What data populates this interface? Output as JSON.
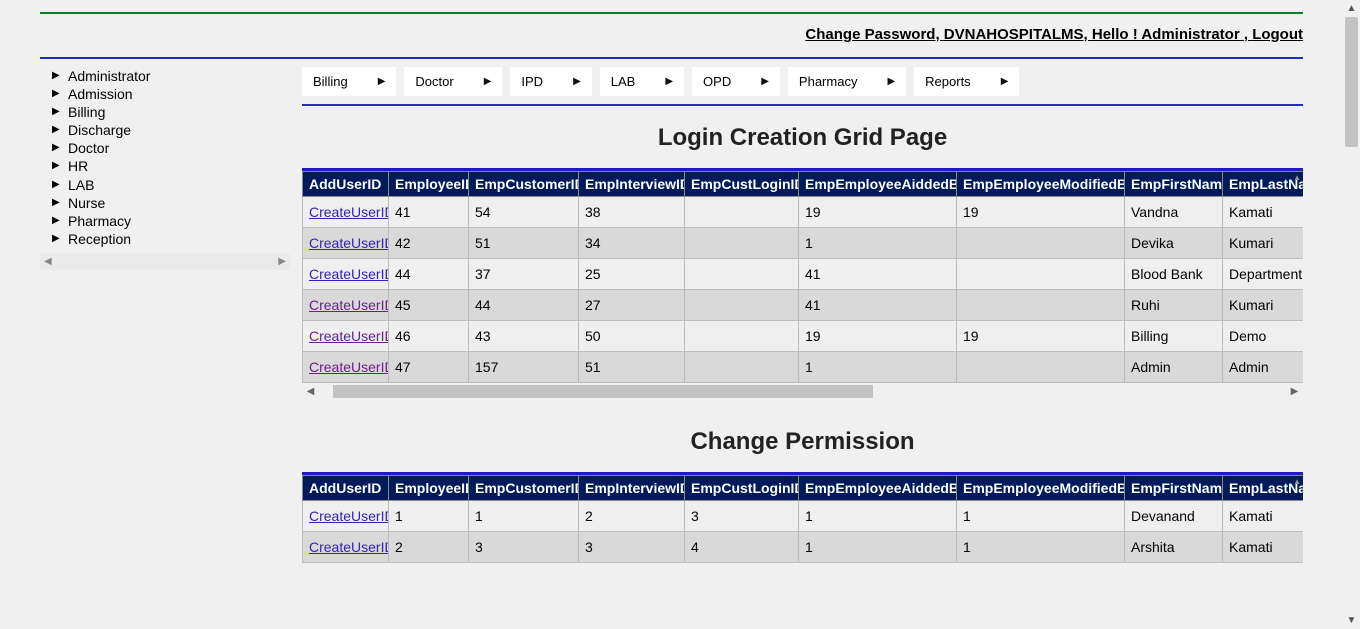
{
  "topbar": {
    "change_password": "Change Password",
    "brand": "DVNAHOSPITALMS",
    "greeting": "Hello ! Administrator ",
    "logout": "Logout"
  },
  "sidebar": {
    "items": [
      "Administrator",
      "Admission",
      "Billing",
      "Discharge",
      "Doctor",
      "HR",
      "LAB",
      "Nurse",
      "Pharmacy",
      "Reception"
    ]
  },
  "menu": {
    "items": [
      "Billing",
      "Doctor",
      "IPD",
      "LAB",
      "OPD",
      "Pharmacy",
      "Reports"
    ]
  },
  "section1": {
    "title": "Login Creation Grid Page",
    "link_label": "CreateUserID",
    "headers": [
      "AddUserID",
      "EmployeeID",
      "EmpCustomerID",
      "EmpInterviewID",
      "EmpCustLoginID",
      "EmpEmployeeAiddedBy",
      "EmpEmployeeModifiedBy",
      "EmpFirstName",
      "EmpLastName"
    ],
    "rows": [
      {
        "emp": "41",
        "cust": "54",
        "intv": "38",
        "login": "",
        "aid": "19",
        "mod": "19",
        "first": "Vandna",
        "last": "Kamati",
        "visited": false
      },
      {
        "emp": "42",
        "cust": "51",
        "intv": "34",
        "login": "",
        "aid": "1",
        "mod": "",
        "first": "Devika",
        "last": "Kumari",
        "visited": false
      },
      {
        "emp": "44",
        "cust": "37",
        "intv": "25",
        "login": "",
        "aid": "41",
        "mod": "",
        "first": "Blood Bank",
        "last": "Department",
        "visited": false
      },
      {
        "emp": "45",
        "cust": "44",
        "intv": "27",
        "login": "",
        "aid": "41",
        "mod": "",
        "first": "Ruhi",
        "last": "Kumari",
        "visited": true
      },
      {
        "emp": "46",
        "cust": "43",
        "intv": "50",
        "login": "",
        "aid": "19",
        "mod": "19",
        "first": "Billing",
        "last": "Demo",
        "visited": true
      },
      {
        "emp": "47",
        "cust": "157",
        "intv": "51",
        "login": "",
        "aid": "1",
        "mod": "",
        "first": "Admin",
        "last": "Admin",
        "visited": true
      }
    ]
  },
  "section2": {
    "title": "Change Permission",
    "link_label": "CreateUserID",
    "headers": [
      "AddUserID",
      "EmployeeID",
      "EmpCustomerID",
      "EmpInterviewID",
      "EmpCustLoginID",
      "EmpEmployeeAiddedBy",
      "EmpEmployeeModifiedBy",
      "EmpFirstName",
      "EmpLastName"
    ],
    "rows": [
      {
        "emp": "1",
        "cust": "1",
        "intv": "2",
        "login": "3",
        "aid": "1",
        "mod": "1",
        "first": "Devanand",
        "last": "Kamati",
        "visited": false
      },
      {
        "emp": "2",
        "cust": "3",
        "intv": "3",
        "login": "4",
        "aid": "1",
        "mod": "1",
        "first": "Arshita",
        "last": "Kamati",
        "visited": false
      }
    ]
  }
}
